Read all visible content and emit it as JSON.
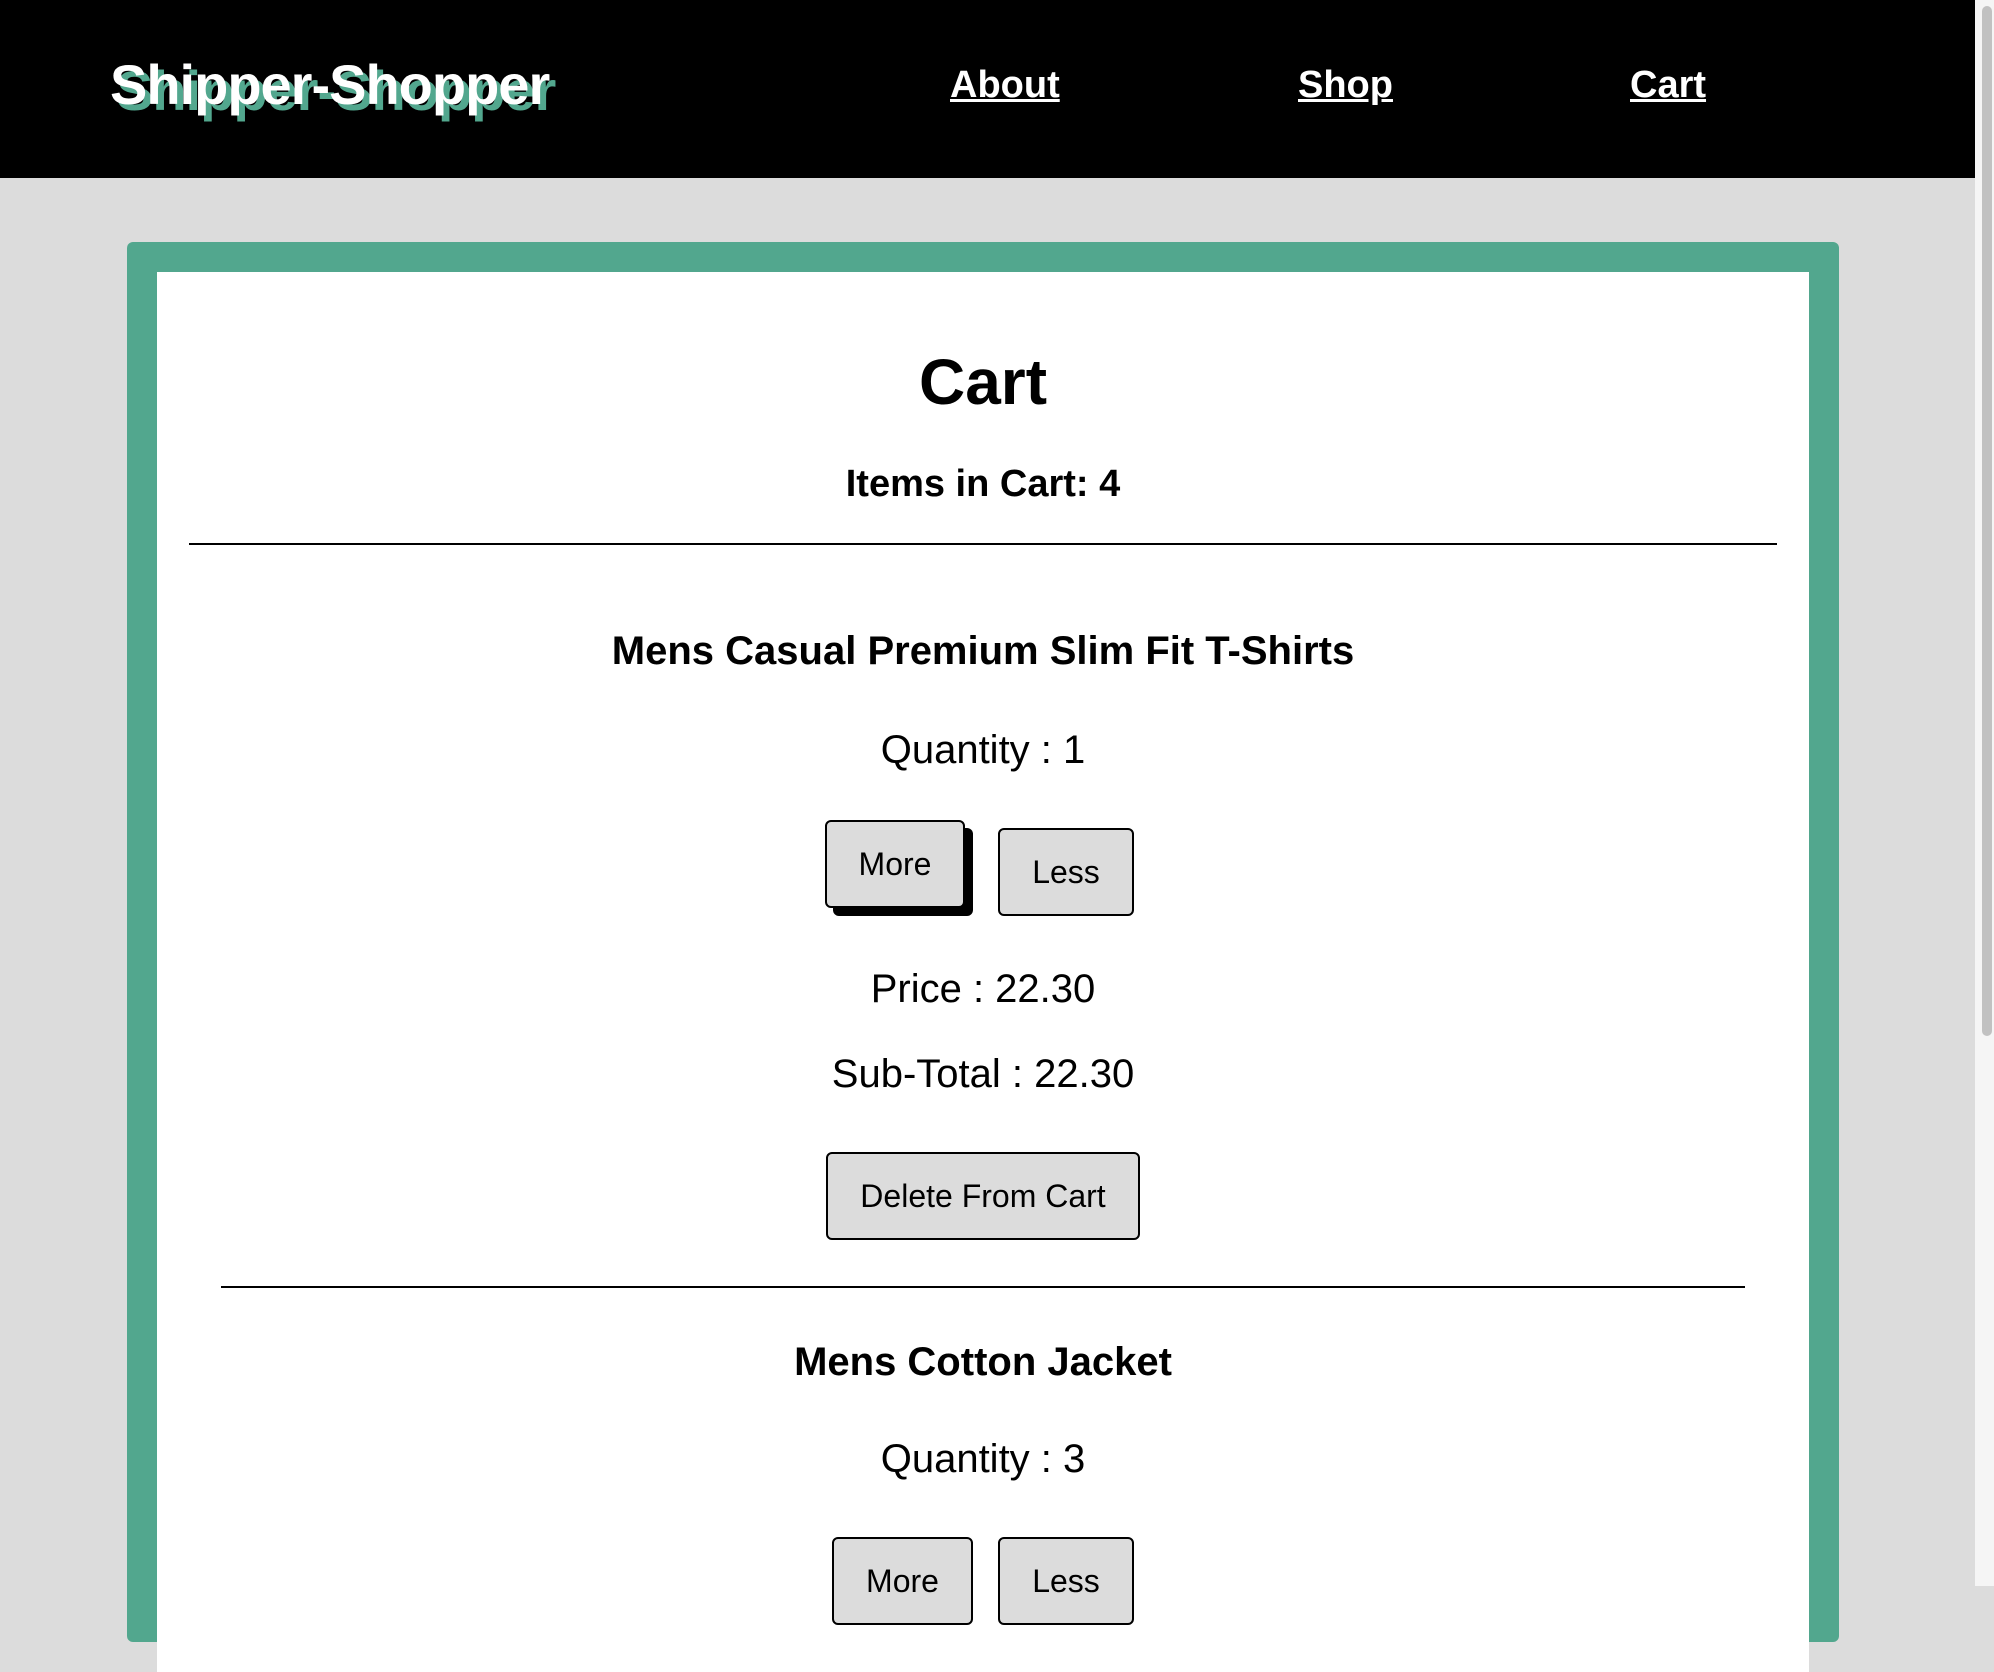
{
  "header": {
    "brand": "Shipper-Shopper",
    "nav": {
      "about": "About",
      "shop": "Shop",
      "cart": "Cart"
    }
  },
  "cart": {
    "title": "Cart",
    "items_count_label": "Items in Cart: 4",
    "items": [
      {
        "name": "Mens Casual Premium Slim Fit T-Shirts",
        "quantity": "Quantity : 1",
        "more_label": "More",
        "less_label": "Less",
        "price": "Price : 22.30",
        "subtotal": "Sub-Total : 22.30",
        "delete_label": "Delete From Cart"
      },
      {
        "name": "Mens Cotton Jacket",
        "quantity": "Quantity : 3",
        "more_label": "More",
        "less_label": "Less"
      }
    ]
  },
  "colors": {
    "accent": "#52a78e",
    "header_bg": "#000000",
    "page_bg": "#dcdcdc",
    "button_bg": "#dcdcdc"
  }
}
